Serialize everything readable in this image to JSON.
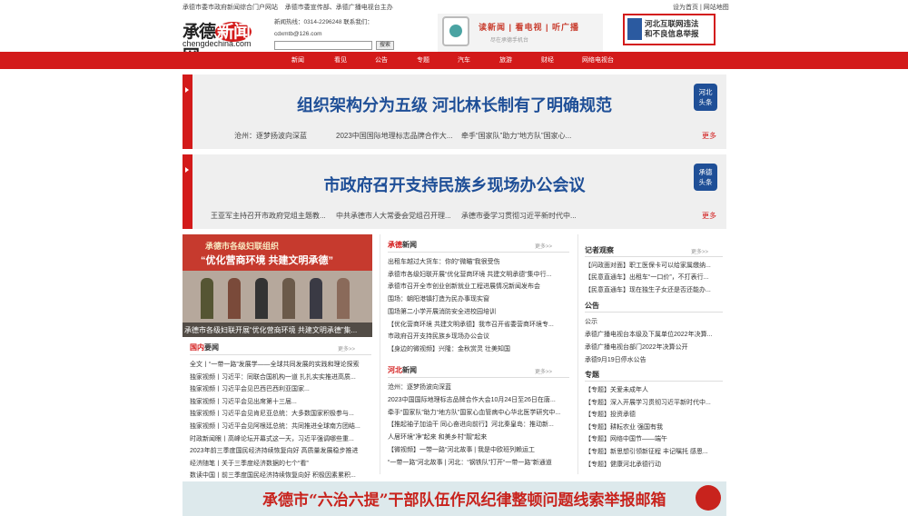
{
  "top": {
    "left_links": [
      "承德市委市政府新闻综合门户网站",
      "承德市委宣传部、承德广播电视台主办"
    ],
    "right_links": [
      "设为首页",
      "网站地图"
    ]
  },
  "header": {
    "logo_cn_a": "承德",
    "logo_cn_b": "新闻",
    "logo_cn_c": "网",
    "logo_en": "chengdechina.com",
    "phone_line": "新闻热线：0314-2296248 联系我们：",
    "email": "cdxmtb@126.com",
    "search_button": "搜索",
    "promo_title": "读新闻 | 看电视 | 听广播",
    "promo_sub": "尽在承德手机台",
    "report_line1": "河北互联网违法",
    "report_line2": "和不良信息举报"
  },
  "nav": [
    "新闻",
    "看见",
    "公告",
    "专题",
    "汽车",
    "旅游",
    "财经",
    "网络电视台"
  ],
  "headline1": {
    "title": "组织架构分为五级 河北林长制有了明确规范",
    "badge": [
      "河北",
      "头条"
    ],
    "subs": [
      "沧州：逐梦扬波向深蓝",
      "2023中国国际地理标志品牌合作大...",
      "牵手“国家队”助力“地方队”国家心..."
    ],
    "more": "更多"
  },
  "headline2": {
    "title": "市政府召开支持民族乡现场办公会议",
    "badge": [
      "承德",
      "头条"
    ],
    "subs": [
      "王亚军主持召开市政府党组主题教...",
      "中共承德市人大常委会党组召开理...",
      "承德市委学习贯彻习近平新时代中..."
    ],
    "more": "更多"
  },
  "photo": {
    "banner_small": "承德市各级妇联组织",
    "banner_big": "“优化营商环境 共建文明承德”",
    "caption": "承德市各级妇联开展“优化营商环境 共建文明承德”集..."
  },
  "guonei": {
    "title_a": "国内",
    "title_b": "要闻",
    "more": "更多>>",
    "items": [
      "全文丨“一带一路”发展学——全球共同发展的实践和理论探索",
      "独家视频丨习近平：同联合国机构一道 扎扎实实推进高质...",
      "独家视频丨习近平会见巴西巴西利亚国家...",
      "独家视频丨习近平会见出席第十三届...",
      "独家视频丨习近平会见肯尼亚总统：大多数国家积极参与...",
      "独家视频丨习近平会见阿根廷总统：共同推进全球南方团结...",
      "时政新闻眼丨高峰论坛开幕式这一天，习近平强调哪些重...",
      "2023年前三季度国民经济持续恢复向好 高质量发展稳步推进",
      "经济随笔丨关于三季度经济数据的七个“看”",
      "数读中国丨前三季度国民经济持续恢复向好 积极因素累积..."
    ]
  },
  "chengde": {
    "title_a": "承德",
    "title_b": "新闻",
    "more": "更多>>",
    "items": [
      "出租车越过大货车：你的“微瞄”我很受伤",
      "承德市各级妇联开展“优化营商环境 共建文明承德”集中行...",
      "承德市召开全市创业创新就业工程进展情况新闻发布会",
      "围场：朝阳港镇打造为民办事现实窗",
      "围场第二小学开展消防安全进校园培训",
      "【优化营商环境 共建文明承德】我市召开省委营商环境专...",
      "市政府召开支持民族乡现场办公会议",
      "【身边的微视频】兴隆：金秋赏灵 壮美知国"
    ]
  },
  "hebei": {
    "title_a": "河北",
    "title_b": "新闻",
    "more": "更多>>",
    "items": [
      "沧州：逐梦扬波向深蓝",
      "2023中国国际地理标志品牌合作大会10月24日至26日在唐...",
      "牵手“国家队”助力“地方队”国家心血管病中心华北医学研究中...",
      "【推起袖子加油干 同心奋进向前行】河北秦皇岛：推动新...",
      "人居环境“净”起来 和美乡村“靓”起来",
      "【微视频】一带一路“河北故事 | 我是中欧班列赖运工",
      "“一带一路”河北故事 | 河北：“钢铁队”打开“一带一路”新通道"
    ]
  },
  "jizhe": {
    "title": "记者观察",
    "more": "更多>>",
    "items": [
      "【问政面对面】职工医保卡可以给家属缴纳...",
      "【民意直通车】出租车“一口价”，不打表行...",
      "【民意直通车】现在独生子女还是否还能办..."
    ]
  },
  "gonggao": {
    "title": "公告",
    "items": [
      "公示",
      "承德广播电视台本级及下属单位2022年决算...",
      "承德广播电视台部门2022年决算公开",
      "承德9月19日停水公告"
    ]
  },
  "zhuanti": {
    "title": "专题",
    "items": [
      "【专题】关爱未成年人",
      "【专题】深入开展学习贯彻习近平新时代中...",
      "【专题】投资承德",
      "【专题】耕耘农业 强国有我",
      "【专题】网络中国节——端午",
      "【专题】新思想引领新征程 丰记嘱托 感恩...",
      "【专题】健康河北承德行动"
    ]
  },
  "footer": {
    "banner": "承德市“六治六提”干部队伍作风纪律整顿问题线索举报邮箱"
  }
}
